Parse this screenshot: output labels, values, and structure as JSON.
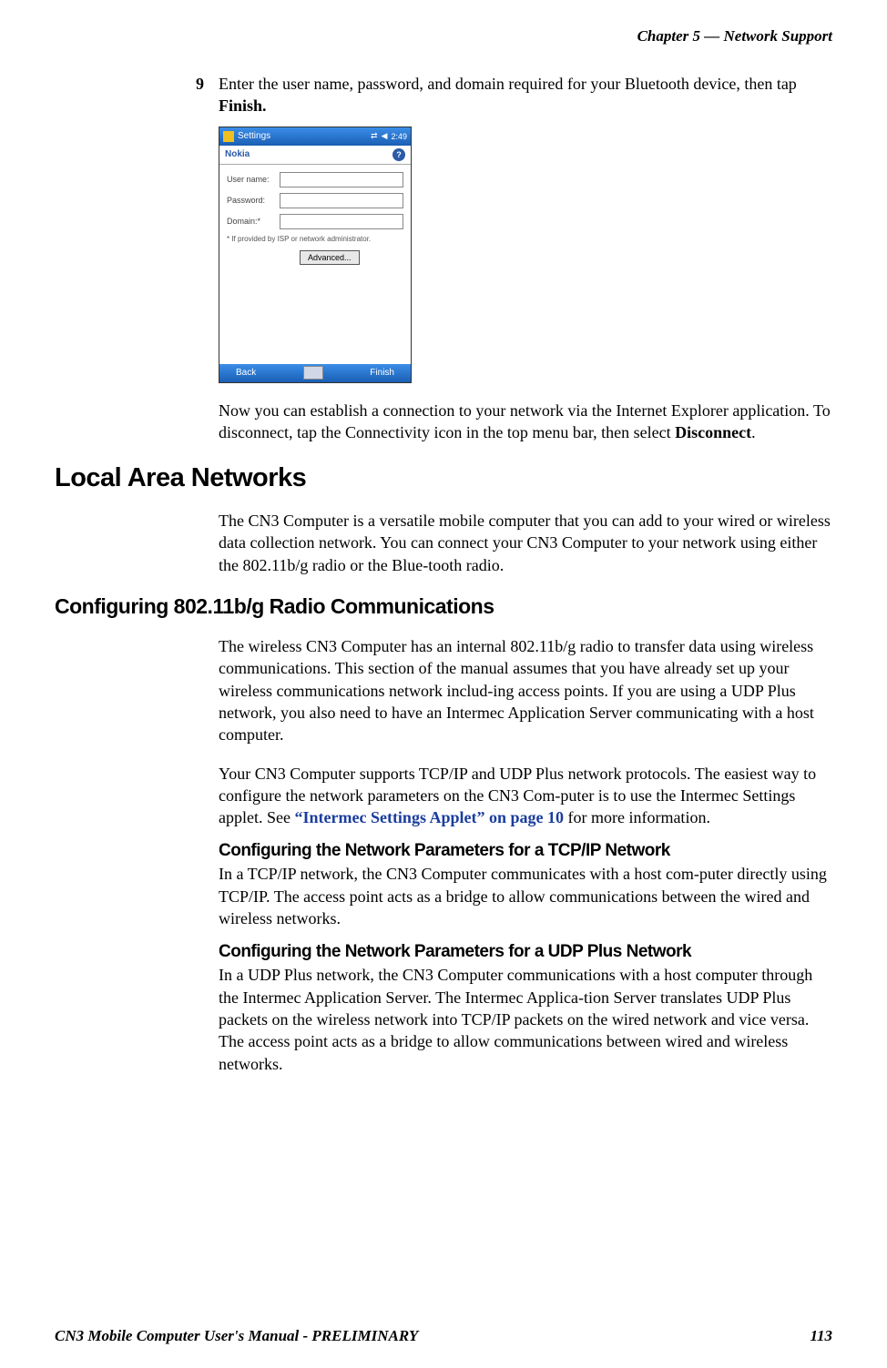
{
  "header": {
    "chapter_label": "Chapter 5 —  Network Support"
  },
  "step9": {
    "number": "9",
    "text_before_bold": "Enter the user name, password, and domain required for your Bluetooth device, then tap ",
    "bold_text": "Finish."
  },
  "screenshot": {
    "title": "Settings",
    "time": "2:49",
    "subtitle": "Nokia",
    "help_char": "?",
    "username_label": "User name:",
    "password_label": "Password:",
    "domain_label": "Domain:*",
    "note": "* If provided by ISP or network administrator.",
    "advanced_btn": "Advanced...",
    "bottom_back": "Back",
    "bottom_finish": "Finish"
  },
  "after_screenshot": {
    "text_p1_a": "Now you can establish a connection to your network via the Internet Explorer application. To disconnect, tap the Connectivity icon in the top menu bar, then select ",
    "text_p1_bold": "Disconnect",
    "text_p1_b": "."
  },
  "sections": {
    "lan_title": "Local Area Networks",
    "lan_intro": "The CN3 Computer is a versatile mobile computer that you can add to your wired or wireless data collection network. You can connect your CN3 Computer to your network using either the 802.11b/g radio or the Blue-tooth radio.",
    "config_80211_title": "Configuring 802.11b/g Radio Communications",
    "config_80211_p1": "The wireless CN3 Computer has an internal 802.11b/g radio to transfer data using wireless communications. This section of the manual assumes that you have already set up your wireless communications network includ-ing access points. If you are using a UDP Plus network, you also need to have an Intermec Application Server communicating with a host computer.",
    "config_80211_p2_a": "Your CN3 Computer supports TCP/IP and UDP Plus network protocols. The easiest way to configure the network parameters on the CN3 Com-puter is to use the Intermec Settings applet. See ",
    "config_80211_link": "“Intermec Settings Applet” on page 10",
    "config_80211_p2_b": " for more information.",
    "tcpip_title": "Configuring the Network Parameters for a TCP/IP Network",
    "tcpip_text": "In a TCP/IP network, the CN3 Computer communicates with a host com-puter directly using TCP/IP. The access point acts as a bridge to allow communications between the wired and wireless networks.",
    "udp_title": "Configuring the Network Parameters for a UDP Plus Network",
    "udp_text": "In a UDP Plus network, the CN3 Computer communications with a host computer through the Intermec Application Server. The Intermec Applica-tion Server translates UDP Plus packets on the wireless network into TCP/IP packets on the wired network and vice versa. The access point acts as a bridge to allow communications between wired and wireless networks."
  },
  "footer": {
    "left": "CN3 Mobile Computer User's Manual - PRELIMINARY",
    "right": "113"
  }
}
